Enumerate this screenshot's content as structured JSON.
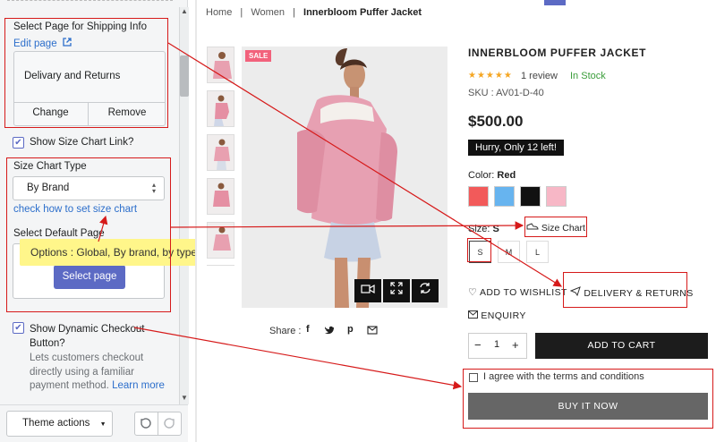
{
  "settings": {
    "shipping_label": "Select Page for Shipping Info",
    "edit_page": "Edit page",
    "shipping_page_name": "Delivary and Returns",
    "change": "Change",
    "remove": "Remove",
    "show_size_chart": "Show Size Chart Link?",
    "size_chart_type_label": "Size Chart Type",
    "size_chart_type_value": "By Brand",
    "check_how": "check how to set size chart",
    "default_page_label": "Select Default Page",
    "select_page": "Select page",
    "options_tooltip": "Options : Global, By brand, by type",
    "dynamic_checkout_label_1": "Show Dynamic Checkout",
    "dynamic_checkout_label_2": "Button?",
    "dynamic_checkout_help_1": "Lets customers checkout",
    "dynamic_checkout_help_2": "directly using a familiar",
    "dynamic_checkout_help_3": "payment method.",
    "learn_more": "Learn more",
    "theme_actions": "Theme actions"
  },
  "breadcrumb": {
    "home": "Home",
    "sep": "|",
    "women": "Women",
    "current": "Innerbloom Puffer Jacket"
  },
  "product": {
    "sale": "SALE",
    "title": "INNERBLOOM PUFFER JACKET",
    "stars": "★★★★★",
    "review": "1 review",
    "stock": "In Stock",
    "sku": "SKU : AV01-D-40",
    "price": "$500.00",
    "hurry": "Hurry, Only 12 left!",
    "color_label": "Color:",
    "color_value": "Red",
    "colors": [
      "#f25a5a",
      "#67b4ef",
      "#111111",
      "#f7b7c6"
    ],
    "size_label": "Size:",
    "size_value": "S",
    "size_chart": "Size Chart",
    "sizes": [
      "S",
      "M",
      "L"
    ],
    "wishlist": "ADD TO WISHLIST",
    "delivery": "DELIVERY & RETURNS",
    "enquiry": "ENQUIRY",
    "qty": "1",
    "minus": "−",
    "plus": "+",
    "add_to_cart": "ADD TO CART",
    "agree": "I agree with the terms and conditions",
    "buy_now": "BUY IT NOW",
    "share": "Share :",
    "accent": "#5c6ac4",
    "annotation_color": "#d61a1a"
  }
}
